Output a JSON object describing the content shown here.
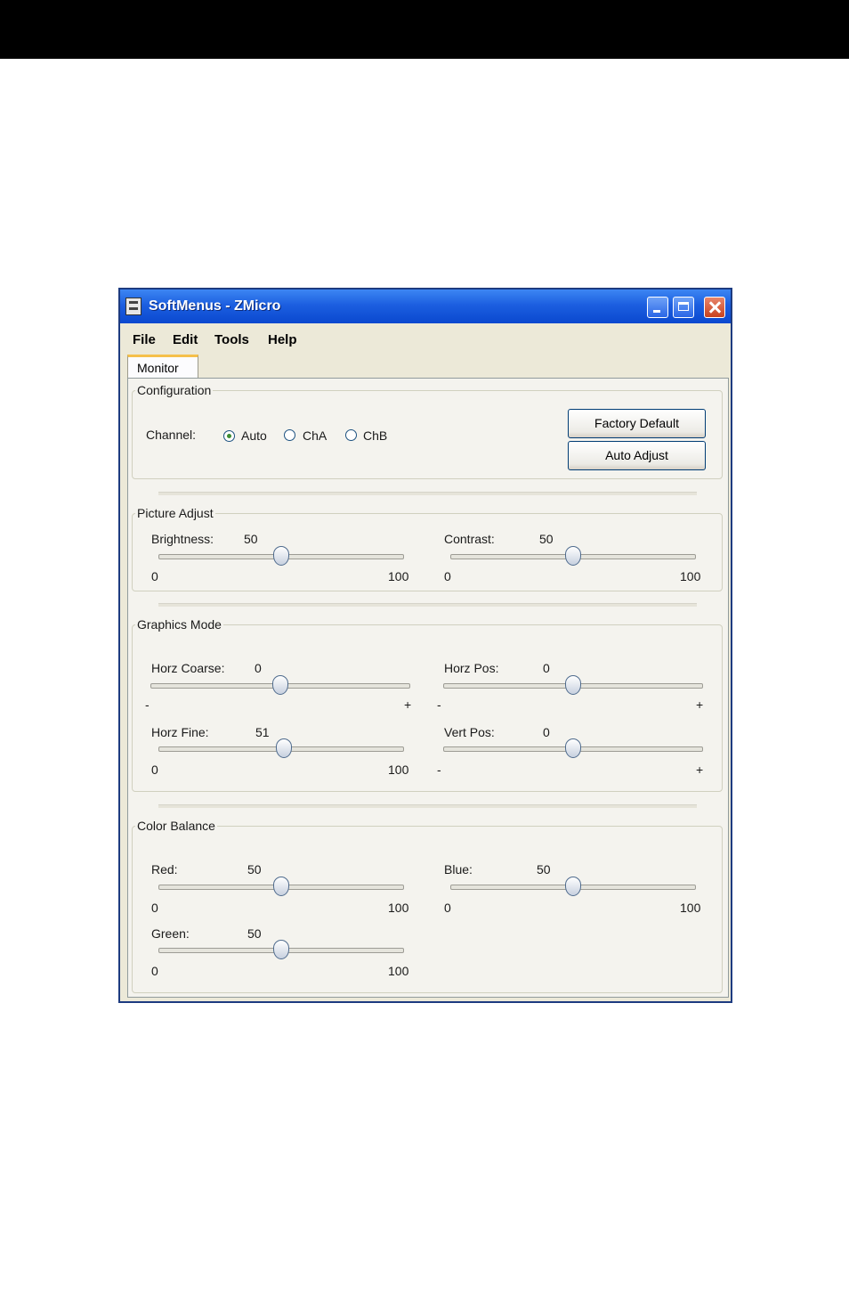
{
  "window": {
    "title": "SoftMenus - ZMicro",
    "title_icon": "app-icon",
    "controls": [
      "minimize-icon",
      "maximize-icon",
      "close-icon"
    ]
  },
  "menu": {
    "file": "File",
    "edit": "Edit",
    "tools": "Tools",
    "help": "Help"
  },
  "tab": {
    "label": "Monitor"
  },
  "configuration": {
    "title": "Configuration",
    "channel_label": "Channel:",
    "options": [
      "Auto",
      "ChA",
      "ChB"
    ],
    "selected": "Auto",
    "factory_default": "Factory Default",
    "auto_adjust": "Auto Adjust"
  },
  "picture_adjust": {
    "title": "Picture Adjust",
    "brightness": {
      "label": "Brightness:",
      "value": "50",
      "min": "0",
      "max": "100",
      "level": 50
    },
    "contrast": {
      "label": "Contrast:",
      "value": "50",
      "min": "0",
      "max": "100",
      "level": 50
    }
  },
  "graphics_mode": {
    "title": "Graphics Mode",
    "horz_coarse": {
      "label": "Horz Coarse:",
      "value": "0",
      "min": "-",
      "max": "+",
      "level": 50
    },
    "horz_pos": {
      "label": "Horz Pos:",
      "value": "0",
      "min": "-",
      "max": "+",
      "level": 50
    },
    "horz_fine": {
      "label": "Horz Fine:",
      "value": "51",
      "min": "0",
      "max": "100",
      "level": 51
    },
    "vert_pos": {
      "label": "Vert Pos:",
      "value": "0",
      "min": "-",
      "max": "+",
      "level": 50
    }
  },
  "color_balance": {
    "title": "Color Balance",
    "red": {
      "label": "Red:",
      "value": "50",
      "min": "0",
      "max": "100",
      "level": 50
    },
    "blue": {
      "label": "Blue:",
      "value": "50",
      "min": "0",
      "max": "100",
      "level": 50
    },
    "green": {
      "label": "Green:",
      "value": "50",
      "min": "0",
      "max": "100",
      "level": 50
    }
  }
}
